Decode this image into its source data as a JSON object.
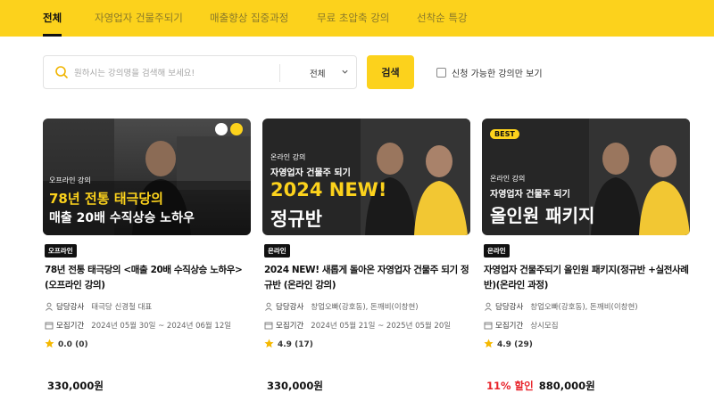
{
  "nav": {
    "tabs": [
      "전체",
      "자영업자 건물주되기",
      "매출향상 집중과정",
      "무료 초압축 강의",
      "선착순 특강"
    ],
    "active_index": 0
  },
  "search": {
    "placeholder": "원하시는 강의명을 검색해 보세요!",
    "category_selected": "전체",
    "button_label": "검색",
    "checkbox_label": "신청 가능한 강의만 보기"
  },
  "labels": {
    "instructor": "담당강사",
    "period": "모집기간"
  },
  "cards": [
    {
      "thumb": {
        "small": "오프라인 강의",
        "line1": "78년 전통 태극당의",
        "line2": "매출 20배 수직상승 노하우",
        "bg": "#3a3a3a"
      },
      "type_badge": "오프라인",
      "title": "78년 전통 태극당의 <매출 20배 수직상승 노하우> (오프라인 강의)",
      "instructor": "태극당 신경철 대표",
      "period": "2024년 05월 30일 ~ 2024년 06월 12일",
      "rating": "0.0 (0)",
      "discount": "",
      "price": "330,000원"
    },
    {
      "thumb": {
        "small": "온라인 강의",
        "line1": "자영업자 건물주 되기",
        "line2": "2024 NEW!",
        "line3": "정규반",
        "bg": "#2b2b2b"
      },
      "type_badge": "온라인",
      "title": "2024 NEW! 새롭게 돌아온 자영업자 건물주 되기 정규반 (온라인 강의)",
      "instructor": "창업오빠(강호동), 돈깨비(이창현)",
      "period": "2024년 05월 21일 ~ 2025년 05월 20일",
      "rating": "4.9 (17)",
      "discount": "",
      "price": "330,000원"
    },
    {
      "thumb": {
        "badge": "BEST",
        "small": "온라인 강의",
        "line1": "자영업자 건물주 되기",
        "line2": "올인원 패키지",
        "bg": "#2b2b2b"
      },
      "type_badge": "온라인",
      "title": "자영업자 건물주되기 올인원 패키지(정규반 +실전사례반)(온라인 과정)",
      "instructor": "창업오빠(강호동), 돈깨비(이창현)",
      "period": "상시모집",
      "rating": "4.9 (29)",
      "discount": "11% 할인",
      "price": "880,000원"
    }
  ],
  "colors": {
    "brand": "#fcd21c",
    "discount": "#e8232a",
    "star": "#f5b800"
  }
}
